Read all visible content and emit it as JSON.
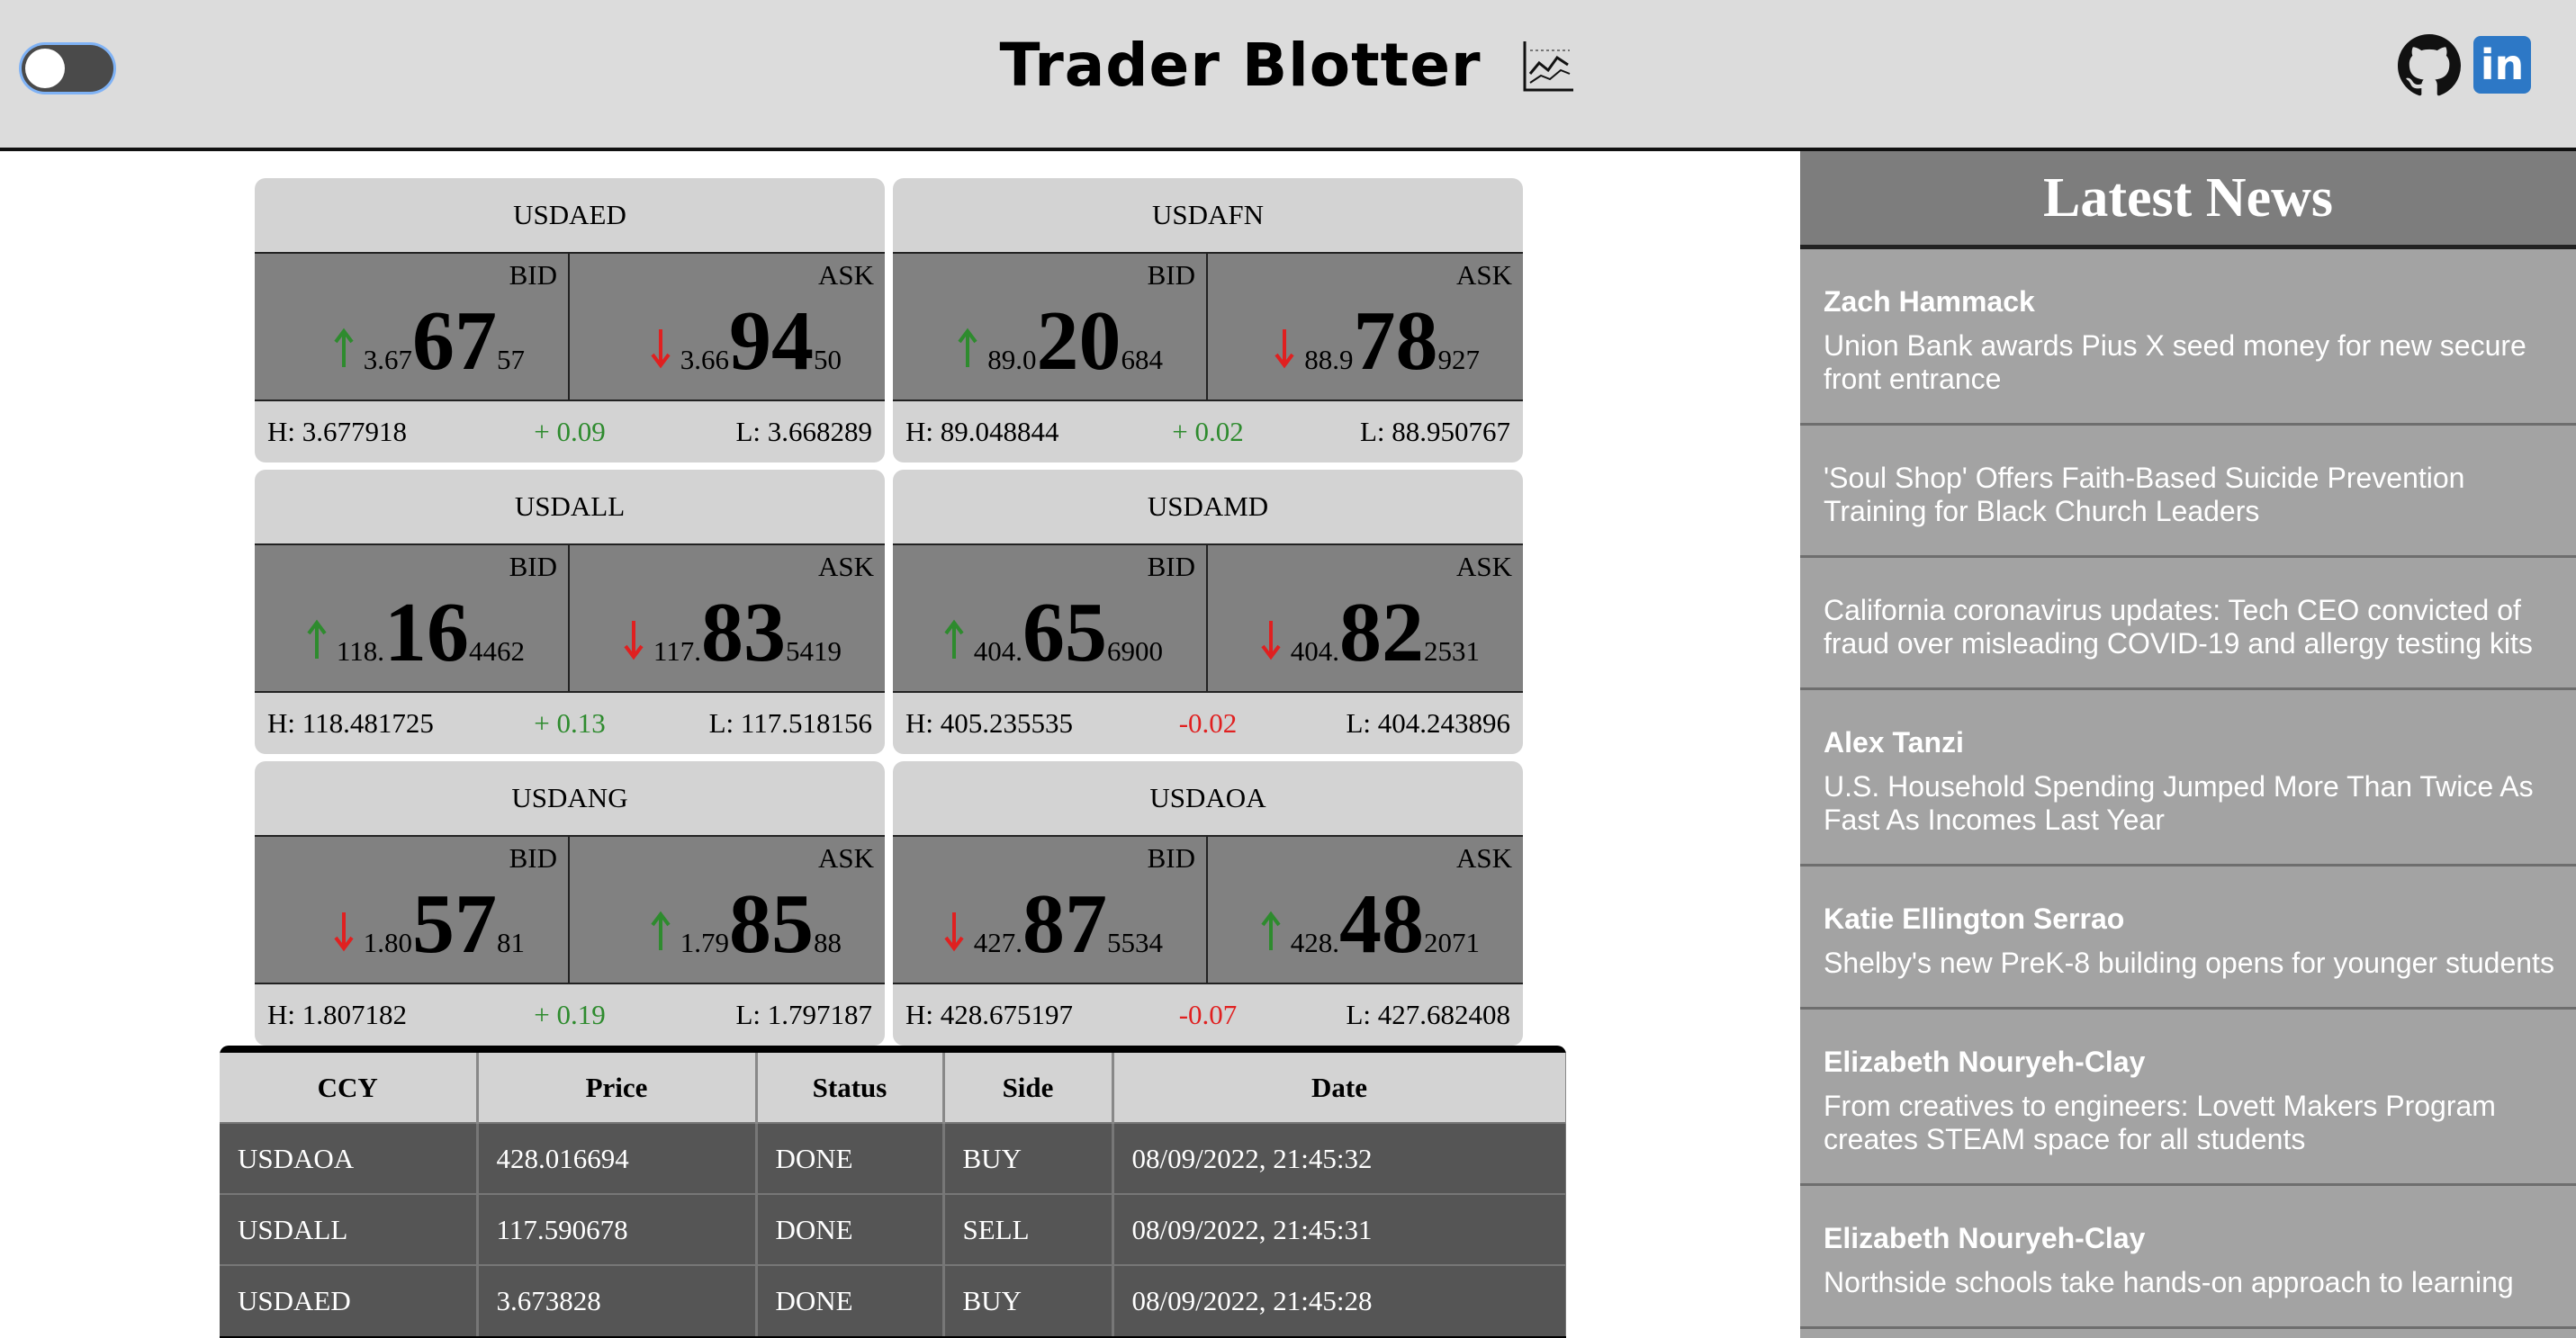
{
  "header": {
    "title": "Trader Blotter",
    "toggle_state": "off",
    "icons": [
      "chart-icon",
      "github-icon",
      "linkedin-icon"
    ]
  },
  "tiles": [
    {
      "ccy": "USDAED",
      "bid_label": "BID",
      "ask_label": "ASK",
      "bid": {
        "pre": "3.67",
        "big": "67",
        "post": "57",
        "dir": "up"
      },
      "ask": {
        "pre": "3.66",
        "big": "94",
        "post": "50",
        "dir": "down"
      },
      "high": "H: 3.677918",
      "change": "+ 0.09",
      "change_dir": "up",
      "low": "L: 3.668289"
    },
    {
      "ccy": "USDAFN",
      "bid_label": "BID",
      "ask_label": "ASK",
      "bid": {
        "pre": "89.0",
        "big": "20",
        "post": "684",
        "dir": "up"
      },
      "ask": {
        "pre": "88.9",
        "big": "78",
        "post": "927",
        "dir": "down"
      },
      "high": "H: 89.048844",
      "change": "+ 0.02",
      "change_dir": "up",
      "low": "L: 88.950767"
    },
    {
      "ccy": "USDALL",
      "bid_label": "BID",
      "ask_label": "ASK",
      "bid": {
        "pre": "118.",
        "big": "16",
        "post": "4462",
        "dir": "up"
      },
      "ask": {
        "pre": "117.",
        "big": "83",
        "post": "5419",
        "dir": "down"
      },
      "high": "H: 118.481725",
      "change": "+ 0.13",
      "change_dir": "up",
      "low": "L: 117.518156"
    },
    {
      "ccy": "USDAMD",
      "bid_label": "BID",
      "ask_label": "ASK",
      "bid": {
        "pre": "404.",
        "big": "65",
        "post": "6900",
        "dir": "up"
      },
      "ask": {
        "pre": "404.",
        "big": "82",
        "post": "2531",
        "dir": "down"
      },
      "high": "H: 405.235535",
      "change": "-0.02",
      "change_dir": "down",
      "low": "L: 404.243896"
    },
    {
      "ccy": "USDANG",
      "bid_label": "BID",
      "ask_label": "ASK",
      "bid": {
        "pre": "1.80",
        "big": "57",
        "post": "81",
        "dir": "down"
      },
      "ask": {
        "pre": "1.79",
        "big": "85",
        "post": "88",
        "dir": "up"
      },
      "high": "H: 1.807182",
      "change": "+ 0.19",
      "change_dir": "up",
      "low": "L: 1.797187"
    },
    {
      "ccy": "USDAOA",
      "bid_label": "BID",
      "ask_label": "ASK",
      "bid": {
        "pre": "427.",
        "big": "87",
        "post": "5534",
        "dir": "down"
      },
      "ask": {
        "pre": "428.",
        "big": "48",
        "post": "2071",
        "dir": "up"
      },
      "high": "H: 428.675197",
      "change": "-0.07",
      "change_dir": "down",
      "low": "L: 427.682408"
    }
  ],
  "blotter": {
    "columns": [
      "CCY",
      "Price",
      "Status",
      "Side",
      "Date"
    ],
    "rows": [
      [
        "USDAOA",
        "428.016694",
        "DONE",
        "BUY",
        "08/09/2022, 21:45:32"
      ],
      [
        "USDALL",
        "117.590678",
        "DONE",
        "SELL",
        "08/09/2022, 21:45:31"
      ],
      [
        "USDAED",
        "3.673828",
        "DONE",
        "BUY",
        "08/09/2022, 21:45:28"
      ]
    ]
  },
  "news": {
    "title": "Latest News",
    "items": [
      {
        "author": "Zach Hammack",
        "headline": "Union Bank awards Pius X seed money for new secure front entrance"
      },
      {
        "author": "",
        "headline": "'Soul Shop' Offers Faith-Based Suicide Prevention Training for Black Church Leaders"
      },
      {
        "author": "",
        "headline": "California coronavirus updates: Tech CEO convicted of fraud over misleading COVID-19 and allergy testing kits"
      },
      {
        "author": "Alex Tanzi",
        "headline": "U.S. Household Spending Jumped More Than Twice As Fast As Incomes Last Year"
      },
      {
        "author": "Katie Ellington Serrao",
        "headline": "Shelby's new PreK-8 building opens for younger students"
      },
      {
        "author": "Elizabeth Nouryeh-Clay",
        "headline": "From creatives to engineers: Lovett Makers Program creates STEAM space for all students"
      },
      {
        "author": "Elizabeth Nouryeh-Clay",
        "headline": "Northside schools take hands-on approach to learning"
      }
    ]
  },
  "colors": {
    "up": "#2e8b2e",
    "down": "#e02020",
    "tile_bg": "#d3d3d3",
    "quote_bg": "#818181",
    "news_bg": "#a3a3a3"
  }
}
